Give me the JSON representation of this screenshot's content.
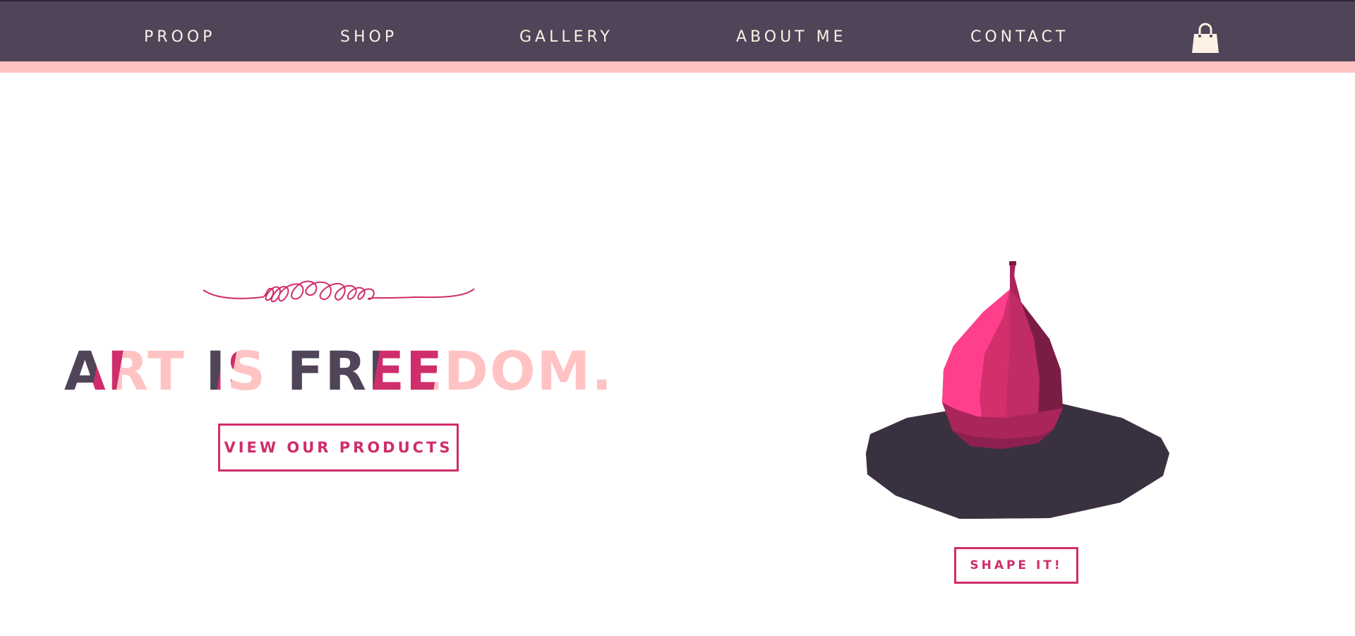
{
  "nav": {
    "items": [
      {
        "label": "PROOP"
      },
      {
        "label": "SHOP"
      },
      {
        "label": "GALLERY"
      },
      {
        "label": "ABOUT ME"
      },
      {
        "label": "CONTACT"
      }
    ],
    "cart_icon": "shopping-bag-icon"
  },
  "hero": {
    "headline_words": [
      "ART",
      "IS",
      "FREEDOM."
    ],
    "cta_label": "VIEW OUR PRODUCTS",
    "shape_label": "SHAPE IT!",
    "ornament_icon": "flourish-ornament"
  },
  "colors": {
    "nav_bg": "#4f4458",
    "nav_stripe": "#ffc3c3",
    "nav_text": "#fdf1e4",
    "accent": "#cf2d6b",
    "dark": "#4f4458",
    "light_pink": "#ffc3c3",
    "bulb_pink": "#ff3f8c",
    "base": "#3a3140"
  }
}
